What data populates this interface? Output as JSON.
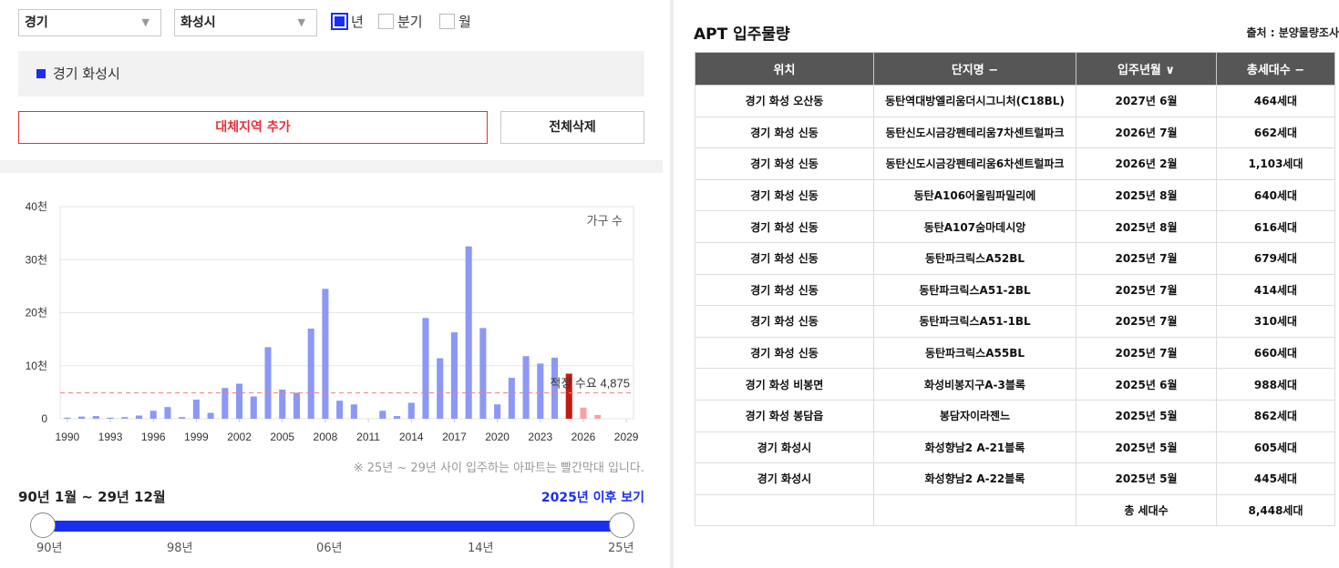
{
  "filters": {
    "province": "경기",
    "city": "화성시",
    "periods": [
      {
        "label": "년",
        "checked": true
      },
      {
        "label": "분기",
        "checked": false
      },
      {
        "label": "월",
        "checked": false
      }
    ]
  },
  "selected_region": "경기 화성시",
  "buttons": {
    "add_region": "대체지역 추가",
    "delete_all": "전체삭제"
  },
  "chart_data": {
    "type": "bar",
    "series_label": "가구 수",
    "x_tick_labels": [
      "1990",
      "1993",
      "1996",
      "1999",
      "2002",
      "2005",
      "2008",
      "2011",
      "2014",
      "2017",
      "2020",
      "2023",
      "2026",
      "2029"
    ],
    "y_tick_labels": [
      "0",
      "10천",
      "20천",
      "30천",
      "40천"
    ],
    "ylim": [
      0,
      40000
    ],
    "xlim": [
      1989.5,
      2029.5
    ],
    "x": [
      1990,
      1991,
      1992,
      1993,
      1994,
      1995,
      1996,
      1997,
      1998,
      1999,
      2000,
      2001,
      2002,
      2003,
      2004,
      2005,
      2006,
      2007,
      2008,
      2009,
      2010,
      2011,
      2012,
      2013,
      2014,
      2015,
      2016,
      2017,
      2018,
      2019,
      2020,
      2021,
      2022,
      2023,
      2024,
      2025,
      2026,
      2027,
      2028,
      2029
    ],
    "values": [
      200,
      400,
      500,
      200,
      300,
      600,
      1500,
      2200,
      300,
      3600,
      1100,
      5800,
      6600,
      4200,
      13500,
      5500,
      4900,
      17000,
      24500,
      3400,
      2700,
      0,
      1500,
      500,
      3000,
      19000,
      11400,
      16300,
      32500,
      17100,
      2700,
      7700,
      11800,
      10400,
      11500,
      8500,
      2100,
      700,
      0,
      0
    ],
    "highlight_from": 2025,
    "highlight_labels": [
      2025
    ],
    "colors": {
      "past": "#8c98f5",
      "future": "#f4a3a3",
      "highlight": "#c41a14",
      "reference": "#f08080"
    },
    "reference_line": {
      "value": 4875,
      "label": "적정 수요 4,875"
    },
    "grid": true
  },
  "chart_note": "※ 25년 ~ 29년 사이 입주하는 아파트는 빨간막대 입니다.",
  "range": {
    "label": "90년 1월 ~ 29년 12월",
    "after_link": "2025년 이후 보기",
    "ticks": [
      "90년",
      "98년",
      "06년",
      "14년",
      "25년"
    ]
  },
  "apt": {
    "title": "APT 입주물량",
    "source": "출처 : 분양물량조사",
    "columns": [
      "위치",
      "단지명 −",
      "입주년월 ∨",
      "총세대수 −"
    ],
    "rows": [
      [
        "경기 화성 오산동",
        "동탄역대방엘리움더시그니처(C18BL)",
        "2027년 6월",
        "464세대"
      ],
      [
        "경기 화성 신동",
        "동탄신도시금강펜테리움7차센트럴파크",
        "2026년 7월",
        "662세대"
      ],
      [
        "경기 화성 신동",
        "동탄신도시금강펜테리움6차센트럴파크",
        "2026년 2월",
        "1,103세대"
      ],
      [
        "경기 화성 신동",
        "동탄A106어울림파밀리에",
        "2025년 8월",
        "640세대"
      ],
      [
        "경기 화성 신동",
        "동탄A107숨마데시앙",
        "2025년 8월",
        "616세대"
      ],
      [
        "경기 화성 신동",
        "동탄파크릭스A52BL",
        "2025년 7월",
        "679세대"
      ],
      [
        "경기 화성 신동",
        "동탄파크릭스A51-2BL",
        "2025년 7월",
        "414세대"
      ],
      [
        "경기 화성 신동",
        "동탄파크릭스A51-1BL",
        "2025년 7월",
        "310세대"
      ],
      [
        "경기 화성 신동",
        "동탄파크릭스A55BL",
        "2025년 7월",
        "660세대"
      ],
      [
        "경기 화성 비봉면",
        "화성비봉지구A-3블록",
        "2025년 6월",
        "988세대"
      ],
      [
        "경기 화성 봉담읍",
        "봉담자이라젠느",
        "2025년 5월",
        "862세대"
      ],
      [
        "경기 화성시",
        "화성향남2 A-21블록",
        "2025년 5월",
        "605세대"
      ],
      [
        "경기 화성시",
        "화성향남2 A-22블록",
        "2025년 5월",
        "445세대"
      ]
    ],
    "total_label": "총 세대수",
    "total_value": "8,448세대"
  }
}
